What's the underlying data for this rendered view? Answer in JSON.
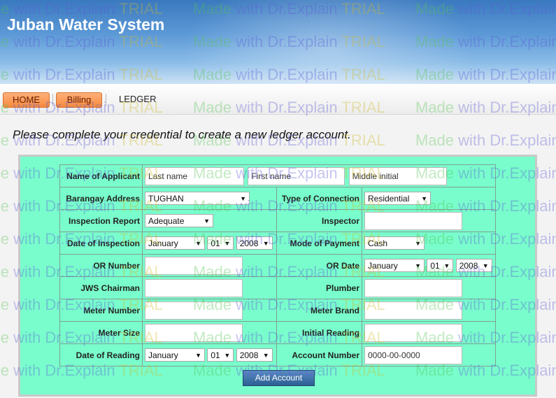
{
  "header": {
    "title": "Juban Water System"
  },
  "nav": {
    "home": "HOME",
    "billing": "Billing",
    "ledger": "LEDGER"
  },
  "instruction": "Please complete your credential to create a new ledger account.",
  "form": {
    "name_label": "Name of Applicant",
    "last_name_placeholder": "Last name",
    "first_name_placeholder": "First name",
    "middle_initial_placeholder": "Middle initial",
    "barangay_label": "Barangay Address",
    "barangay_value": "TUGHAN",
    "connection_label": "Type of Connection",
    "connection_value": "Residential",
    "inspection_report_label": "Inspection Report",
    "inspection_report_value": "Adequate",
    "inspector_label": "Inspector",
    "inspection_date_label": "Date of Inspection",
    "inspection_month": "January",
    "inspection_day": "01",
    "inspection_year": "2008",
    "payment_label": "Mode of Payment",
    "payment_value": "Cash",
    "or_number_label": "OR Number",
    "or_date_label": "OR Date",
    "or_month": "January",
    "or_day": "01",
    "or_year": "2008",
    "chairman_label": "JWS Chairman",
    "plumber_label": "Plumber",
    "meter_number_label": "Meter Number",
    "meter_brand_label": "Meter Brand",
    "meter_size_label": "Meter Size",
    "initial_reading_label": "Initial Reading",
    "reading_date_label": "Date of Reading",
    "reading_month": "January",
    "reading_day": "01",
    "reading_year": "2008",
    "account_number_label": "Account Number",
    "account_number_value": "0000-00-0000",
    "submit_label": "Add Account"
  },
  "watermark": {
    "part1": "Made",
    "part2": "with Dr.Explain",
    "part3": "TRIAL"
  }
}
